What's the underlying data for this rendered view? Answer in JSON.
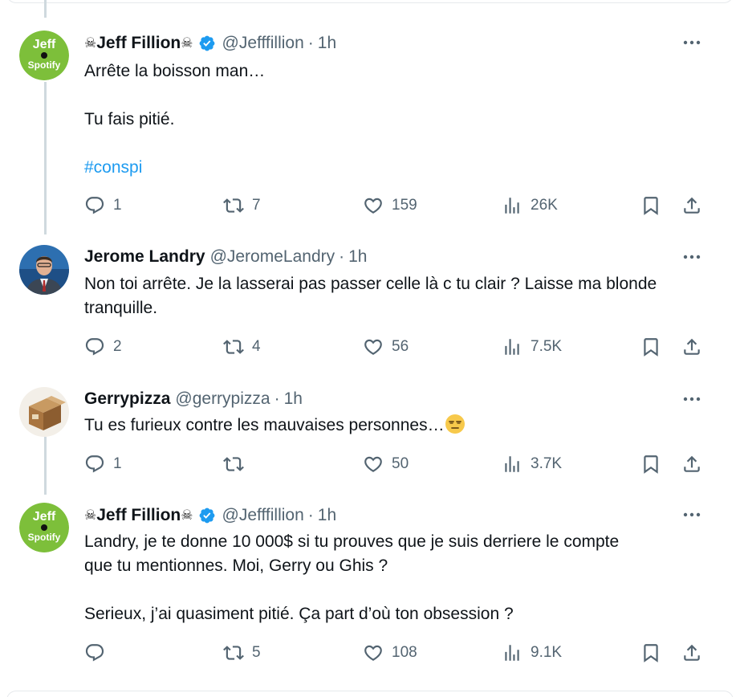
{
  "tweets": [
    {
      "name": "Jeff Fillion",
      "handle": "@Jefffillion",
      "sep": "·",
      "time": "1h",
      "avatar_texts": [
        "Jeff",
        "Spotify"
      ],
      "lines": [
        "Arrête la boisson man…",
        "",
        "Tu fais pitié.",
        "",
        "#conspi"
      ],
      "replies": "1",
      "retweets": "7",
      "likes": "159",
      "views": "26K"
    },
    {
      "name": "Jerome Landry",
      "handle": "@JeromeLandry",
      "sep": "·",
      "time": "1h",
      "lines": [
        "Non toi arrête. Je la lasserai pas passer celle là c tu clair ? Laisse ma blonde",
        "tranquille."
      ],
      "replies": "2",
      "retweets": "4",
      "likes": "56",
      "views": "7.5K"
    },
    {
      "name": "Gerrypizza",
      "handle": "@gerrypizza",
      "sep": "·",
      "time": "1h",
      "lines": [
        "Tu es furieux contre les mauvaises personnes…"
      ],
      "replies": "1",
      "retweets": "",
      "likes": "50",
      "views": "3.7K"
    },
    {
      "name": "Jeff Fillion",
      "handle": "@Jefffillion",
      "sep": "·",
      "time": "1h",
      "avatar_texts": [
        "Jeff",
        "Spotify"
      ],
      "lines": [
        "Landry, je te donne 10 000$ si tu prouves que je suis derriere le compte",
        "que tu mentionnes. Moi, Gerry ou Ghis ?",
        "",
        "Serieux, j’ai quasiment pitié. Ça part d’où ton obsession ?"
      ],
      "replies": "",
      "retweets": "5",
      "likes": "108",
      "views": "9.1K"
    }
  ],
  "skull_glyph": "☠",
  "icons": [
    "reply-icon",
    "retweet-icon",
    "like-icon",
    "views-icon",
    "bookmark-icon",
    "share-icon",
    "more-icon",
    "verified-icon",
    "unamused-emoji"
  ],
  "colors": {
    "text": "#0f1419",
    "secondary": "#536471",
    "accent": "#1d9bf0",
    "thread": "#cfd9de",
    "avatar_green": "#7dbf3a"
  }
}
